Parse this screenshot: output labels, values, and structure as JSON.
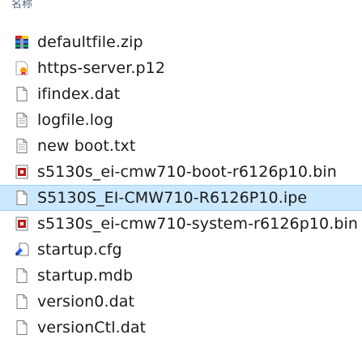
{
  "header": {
    "name_column": "名称"
  },
  "files": [
    {
      "name": "defaultfile.zip",
      "icon": "archive-icon"
    },
    {
      "name": "https-server.p12",
      "icon": "certificate-icon"
    },
    {
      "name": "ifindex.dat",
      "icon": "blank-file-icon"
    },
    {
      "name": "logfile.log",
      "icon": "text-file-icon"
    },
    {
      "name": "new boot.txt",
      "icon": "text-file-icon"
    },
    {
      "name": "s5130s_ei-cmw710-boot-r6126p10.bin",
      "icon": "binary-file-icon"
    },
    {
      "name": "S5130S_EI-CMW710-R6126P10.ipe",
      "icon": "blank-file-icon",
      "selected": true
    },
    {
      "name": "s5130s_ei-cmw710-system-r6126p10.bin",
      "icon": "binary-file-icon"
    },
    {
      "name": "startup.cfg",
      "icon": "config-file-icon"
    },
    {
      "name": "startup.mdb",
      "icon": "blank-file-icon"
    },
    {
      "name": "version0.dat",
      "icon": "blank-file-icon"
    },
    {
      "name": "versionCtl.dat",
      "icon": "blank-file-icon"
    }
  ],
  "colors": {
    "selection_bg": "#cce8ff",
    "selection_border": "#99d1ff",
    "text": "#1a1a1a",
    "header_text": "#4c607a"
  }
}
